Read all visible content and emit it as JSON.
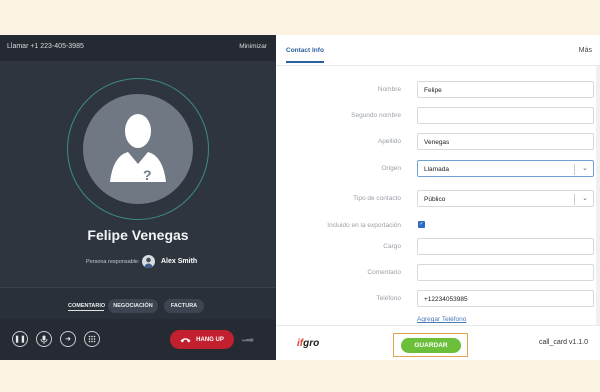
{
  "call_panel": {
    "title": "Llamar +1 223-405-3985",
    "minimize_label": "Minimizar",
    "contact_name": "Felipe Venegas",
    "responsible_label": "Persona responsable:",
    "responsible_name": "Alex Smith",
    "tabs": [
      "COMENTARIO",
      "NEGOCIACIÓN",
      "FACTURA"
    ],
    "hangup_label": "HANG UP",
    "controls": [
      "pause-icon",
      "microphone-icon",
      "forward-icon",
      "keypad-icon"
    ]
  },
  "contact_info": {
    "tab_label": "Contact Info",
    "more_label": "Más",
    "fields": [
      {
        "label": "Nombre",
        "value": "Felipe"
      },
      {
        "label": "Segundo nombre",
        "value": ""
      },
      {
        "label": "Apellido",
        "value": "Venegas"
      },
      {
        "label": "Origen",
        "value": "Llamada"
      },
      {
        "label": "Tipo de contacto",
        "value": "Público"
      },
      {
        "label": "Incluido en la exportación",
        "value": "checked"
      },
      {
        "label": "Cargo",
        "value": ""
      },
      {
        "label": "Comentario",
        "value": ""
      },
      {
        "label": "Teléfono",
        "value": "+12234053985"
      }
    ],
    "add_phone_label": "Agregar Teléfono"
  },
  "footer": {
    "logo_text": "gro",
    "save_label": "GUARDAR",
    "version": "call_card v1.1.0"
  },
  "colors": {
    "accent": "#2c5f9e",
    "save": "#6cbf3b",
    "hangup": "#c2202e",
    "panel": "#2f353f"
  }
}
